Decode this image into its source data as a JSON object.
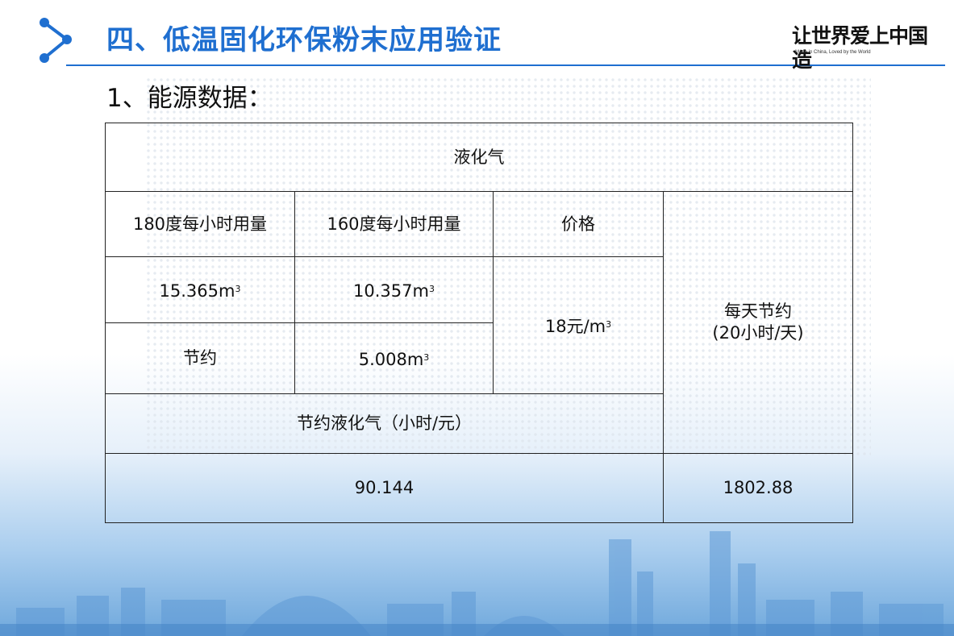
{
  "header": {
    "title": "四、低温固化环保粉末应用验证",
    "brand_slogan": "让世界爱上中国造",
    "brand_tagline": "Made in China, Loved by the World"
  },
  "section": {
    "subtitle": "1、能源数据："
  },
  "table": {
    "gas_header": "液化气",
    "col_180": "180度每小时用量",
    "col_160": "160度每小时用量",
    "col_price": "价格",
    "daily_saving_label_line1": "每天节约",
    "daily_saving_label_line2": "(20小时/天)",
    "usage_180_value": "15.365m",
    "usage_160_value": "10.357m",
    "cube_exponent": "3",
    "price_value": "18元/m",
    "saving_label": "节约",
    "saving_value": "5.008m",
    "hourly_saving_label": "节约液化气（小时/元）",
    "hourly_saving_value": "90.144",
    "daily_saving_value": "1802.88"
  },
  "colors": {
    "accent": "#1f6fd0",
    "brand_red": "#c8161d"
  }
}
